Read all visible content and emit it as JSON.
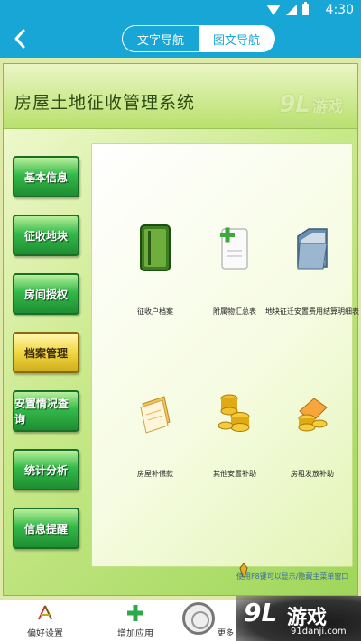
{
  "status_bar": {
    "time": "4:30",
    "icons": [
      "wifi-icon",
      "signal-icon",
      "battery-icon"
    ]
  },
  "nav": {
    "tabs": [
      {
        "label": "文字导航",
        "active": false
      },
      {
        "label": "图文导航",
        "active": true
      }
    ]
  },
  "app": {
    "title": "房屋土地征收管理系统",
    "watermark_number": "9L",
    "watermark_text": "游戏",
    "watermark_url": "www.91danji.com"
  },
  "menu": [
    {
      "label": "基本信息",
      "selected": false
    },
    {
      "label": "征收地块",
      "selected": false
    },
    {
      "label": "房间授权",
      "selected": false
    },
    {
      "label": "档案管理",
      "selected": true
    },
    {
      "label": "安置情况查询",
      "selected": false
    },
    {
      "label": "统计分析",
      "selected": false
    },
    {
      "label": "信息提醒",
      "selected": false
    }
  ],
  "tiles": [
    {
      "label": "征收户档案",
      "icon": "folder-icon"
    },
    {
      "label": "附属物汇总表",
      "icon": "add-document-icon"
    },
    {
      "label": "地块征迁安置费用结算明细表",
      "icon": "file-folder-icon"
    },
    {
      "label": "房屋补偿款",
      "icon": "paper-stack-icon"
    },
    {
      "label": "其他安置补助",
      "icon": "coins-icon"
    },
    {
      "label": "房租发放补助",
      "icon": "coins-gold-icon"
    }
  ],
  "tip": "使用F8键可以显示/隐藏主菜单窗口",
  "bottom_tabs": [
    {
      "label": "偏好设置",
      "icon": "preferences-icon"
    },
    {
      "label": "增加应用",
      "icon": "plus-icon"
    },
    {
      "label": "更多",
      "icon": "ring-icon"
    }
  ],
  "corner_logo": {
    "number": "9L",
    "text": "游戏",
    "url": "91danji.com"
  },
  "colors": {
    "accent": "#17a6d6",
    "menu_green": "#2aa43e",
    "menu_selected": "#f1d743"
  }
}
